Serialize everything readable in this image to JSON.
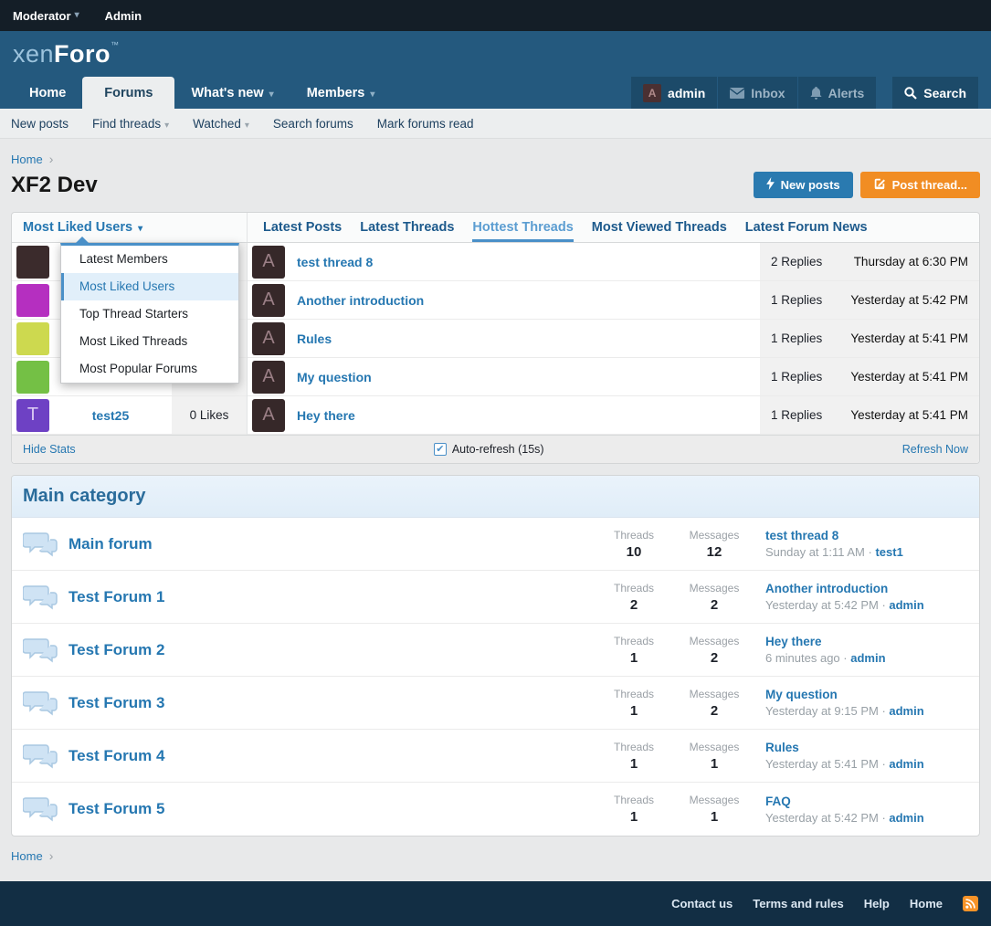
{
  "topbar": {
    "moderator": "Moderator",
    "admin": "Admin"
  },
  "logo": {
    "xen": "xen",
    "foro": "Foro",
    "mark": "™"
  },
  "nav": {
    "tabs": [
      {
        "label": "Home",
        "active": false
      },
      {
        "label": "Forums",
        "active": true
      },
      {
        "label": "What's new",
        "active": false
      },
      {
        "label": "Members",
        "active": false
      }
    ],
    "user": {
      "name": "admin",
      "avatar_letter": "A"
    },
    "inbox_label": "Inbox",
    "alerts_label": "Alerts",
    "search_label": "Search"
  },
  "subnav": {
    "items": [
      {
        "label": "New posts"
      },
      {
        "label": "Find threads"
      },
      {
        "label": "Watched"
      },
      {
        "label": "Search forums"
      },
      {
        "label": "Mark forums read"
      }
    ]
  },
  "breadcrumb": {
    "home": "Home"
  },
  "page": {
    "title": "XF2 Dev",
    "new_posts_button": "New posts",
    "post_thread_button": "Post thread..."
  },
  "stats_widget": {
    "selector_label": "Most Liked Users",
    "dropdown": {
      "selected_index": 1,
      "items": [
        {
          "label": "Latest Members"
        },
        {
          "label": "Most Liked Users"
        },
        {
          "label": "Top Thread Starters"
        },
        {
          "label": "Most Liked Threads"
        },
        {
          "label": "Most Popular Forums"
        }
      ]
    },
    "members": [
      {
        "avatar_color": "#3b2b2c",
        "avatar_letter": "",
        "username": "",
        "likes": ""
      },
      {
        "avatar_color": "#b52fc0",
        "avatar_letter": "",
        "username": "",
        "likes": ""
      },
      {
        "avatar_color": "#cdd94f",
        "avatar_letter": "",
        "username": "",
        "likes": ""
      },
      {
        "avatar_color": "#74c045",
        "avatar_letter": "",
        "username": "",
        "likes": ""
      },
      {
        "avatar_color": "#6e41c4",
        "avatar_letter": "T",
        "username": "test25",
        "likes": "0 Likes"
      }
    ],
    "tabs": [
      {
        "label": "Latest Posts",
        "active": false
      },
      {
        "label": "Latest Threads",
        "active": false
      },
      {
        "label": "Hottest Threads",
        "active": true
      },
      {
        "label": "Most Viewed Threads",
        "active": false
      },
      {
        "label": "Latest Forum News",
        "active": false
      }
    ],
    "threads": [
      {
        "avatar_letter": "A",
        "title": "test thread 8",
        "replies": "2 Replies",
        "date": "Thursday at 6:30 PM"
      },
      {
        "avatar_letter": "A",
        "title": "Another introduction",
        "replies": "1 Replies",
        "date": "Yesterday at 5:42 PM"
      },
      {
        "avatar_letter": "A",
        "title": "Rules",
        "replies": "1 Replies",
        "date": "Yesterday at 5:41 PM"
      },
      {
        "avatar_letter": "A",
        "title": "My question",
        "replies": "1 Replies",
        "date": "Yesterday at 5:41 PM"
      },
      {
        "avatar_letter": "A",
        "title": "Hey there",
        "replies": "1 Replies",
        "date": "Yesterday at 5:41 PM"
      }
    ],
    "footer": {
      "hide_stats": "Hide Stats",
      "auto_refresh": "Auto-refresh (15s)",
      "refresh_now": "Refresh Now"
    }
  },
  "category": {
    "title": "Main category",
    "threads_label": "Threads",
    "messages_label": "Messages",
    "forums": [
      {
        "name": "Main forum",
        "threads": "10",
        "messages": "12",
        "last_title": "test thread 8",
        "last_meta": "Sunday at 1:11 AM",
        "last_user": "test1"
      },
      {
        "name": "Test Forum 1",
        "threads": "2",
        "messages": "2",
        "last_title": "Another introduction",
        "last_meta": "Yesterday at 5:42 PM",
        "last_user": "admin"
      },
      {
        "name": "Test Forum 2",
        "threads": "1",
        "messages": "2",
        "last_title": "Hey there",
        "last_meta": "6 minutes ago",
        "last_user": "admin"
      },
      {
        "name": "Test Forum 3",
        "threads": "1",
        "messages": "2",
        "last_title": "My question",
        "last_meta": "Yesterday at 9:15 PM",
        "last_user": "admin"
      },
      {
        "name": "Test Forum 4",
        "threads": "1",
        "messages": "1",
        "last_title": "Rules",
        "last_meta": "Yesterday at 5:41 PM",
        "last_user": "admin"
      },
      {
        "name": "Test Forum 5",
        "threads": "1",
        "messages": "1",
        "last_title": "FAQ",
        "last_meta": "Yesterday at 5:42 PM",
        "last_user": "admin"
      }
    ]
  },
  "footer": {
    "links": [
      {
        "label": "Contact us"
      },
      {
        "label": "Terms and rules"
      },
      {
        "label": "Help"
      },
      {
        "label": "Home"
      }
    ]
  },
  "colors": {
    "topbar_bg": "#141e27",
    "header_blue": "#24597e",
    "nav_tile_bg": "#1c4a69",
    "link_blue": "#2577b1",
    "active_tab_blue": "#5b9dd1",
    "tab_underline": "#4a90c8",
    "button_blue": "#2a7ab0",
    "button_orange": "#f18d23",
    "thread_avatar_bg": "#362829",
    "footer_bg": "#122e44",
    "rss_orange": "#f79328"
  }
}
